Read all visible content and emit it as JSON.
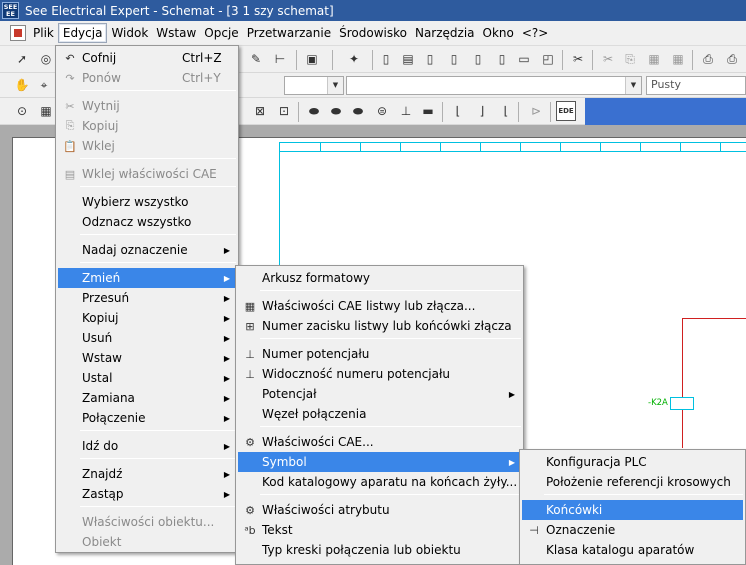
{
  "title_bar": {
    "app_icon": "SEE\nEE",
    "title": "See Electrical Expert - Schemat - [3 1 szy schemat]"
  },
  "menubar": {
    "items": [
      {
        "label": "Plik"
      },
      {
        "label": "Edycja"
      },
      {
        "label": "Widok"
      },
      {
        "label": "Wstaw"
      },
      {
        "label": "Opcje"
      },
      {
        "label": "Przetwarzanie"
      },
      {
        "label": "Środowisko"
      },
      {
        "label": "Narzędzia"
      },
      {
        "label": "Okno"
      },
      {
        "label": "<?>"
      }
    ]
  },
  "toolbar": {
    "style_combo_value": "Pusty"
  },
  "canvas": {
    "component_label": "-K2A"
  },
  "edit_menu": {
    "items": [
      {
        "label": "Cofnij",
        "shortcut": "Ctrl+Z",
        "icon": "undo-icon",
        "glyph": "↶"
      },
      {
        "label": "Ponów",
        "shortcut": "Ctrl+Y",
        "icon": "redo-icon",
        "glyph": "↷"
      },
      {
        "label": "Wytnij",
        "icon": "scissors-icon",
        "glyph": "✂"
      },
      {
        "label": "Kopiuj",
        "icon": "copy-icon",
        "glyph": "⎘"
      },
      {
        "label": "Wklej",
        "icon": "paste-icon",
        "glyph": "📋"
      },
      {
        "label": "Wklej właściwości CAE",
        "icon": "paste-properties-icon",
        "glyph": "▤"
      },
      {
        "label": "Wybierz wszystko"
      },
      {
        "label": "Odznacz wszystko"
      },
      {
        "label": "Nadaj oznaczenie"
      },
      {
        "label": "Zmień"
      },
      {
        "label": "Przesuń"
      },
      {
        "label": "Kopiuj"
      },
      {
        "label": "Usuń"
      },
      {
        "label": "Wstaw"
      },
      {
        "label": "Ustal"
      },
      {
        "label": "Zamiana"
      },
      {
        "label": "Połączenie"
      },
      {
        "label": "Idź do"
      },
      {
        "label": "Znajdź"
      },
      {
        "label": "Zastąp"
      },
      {
        "label": "Właściwości obiektu..."
      },
      {
        "label": "Obiekt"
      }
    ]
  },
  "change_submenu": {
    "items": [
      {
        "label": "Arkusz formatowy"
      },
      {
        "label": "Właściwości CAE listwy lub złącza...",
        "icon": "terminal-strip-icon",
        "glyph": "▦"
      },
      {
        "label": "Numer zacisku listwy lub końcówki złącza",
        "icon": "terminal-number-icon",
        "glyph": "⊞"
      },
      {
        "label": "Numer potencjału",
        "icon": "potential-number-icon",
        "glyph": "⊥"
      },
      {
        "label": "Widoczność numeru potencjału",
        "icon": "potential-visibility-icon",
        "glyph": "⊥"
      },
      {
        "label": "Potencjał"
      },
      {
        "label": "Węzeł połączenia"
      },
      {
        "label": "Właściwości CAE...",
        "icon": "cae-properties-icon",
        "glyph": "⚙"
      },
      {
        "label": "Symbol"
      },
      {
        "label": "Kod katalogowy aparatu na końcach żyły..."
      },
      {
        "label": "Właściwości atrybutu",
        "icon": "attribute-properties-icon",
        "glyph": "⚙"
      },
      {
        "label": "Tekst",
        "icon": "text-icon",
        "glyph": "ᵃb"
      },
      {
        "label": "Typ kreski połączenia lub obiektu"
      }
    ]
  },
  "symbol_submenu": {
    "items": [
      {
        "label": "Konfiguracja PLC"
      },
      {
        "label": "Położenie referencji krosowych"
      },
      {
        "label": "Końcówki"
      },
      {
        "label": "Oznaczenie",
        "icon": "designation-icon",
        "glyph": "⊣"
      },
      {
        "label": "Klasa katalogu aparatów"
      }
    ]
  }
}
